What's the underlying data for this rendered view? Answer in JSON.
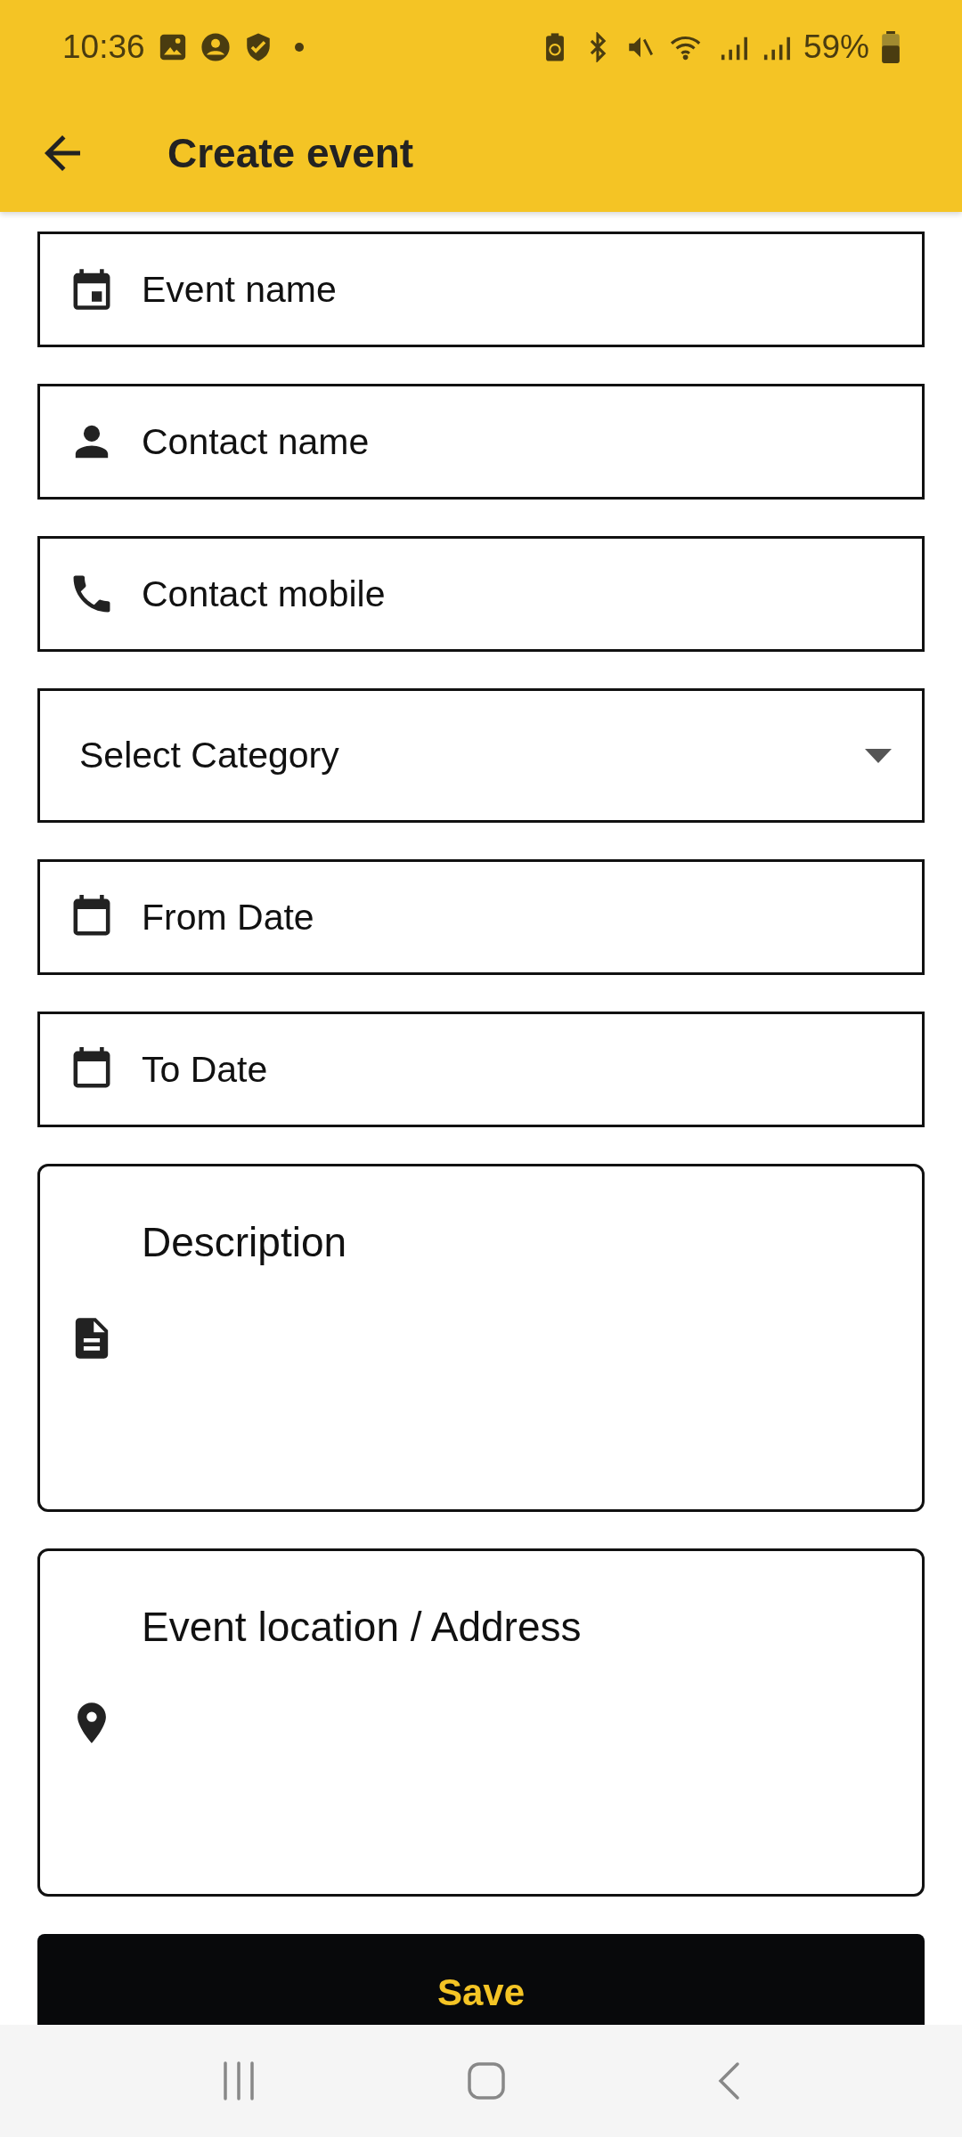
{
  "status_bar": {
    "time": "10:36",
    "battery": "59%"
  },
  "app_bar": {
    "title": "Create event"
  },
  "fields": [
    {
      "kind": "text",
      "placeholder": "Event name"
    },
    {
      "kind": "text",
      "placeholder": "Contact name"
    },
    {
      "kind": "text",
      "placeholder": "Contact mobile"
    },
    {
      "kind": "select",
      "placeholder": "Select Category"
    },
    {
      "kind": "text",
      "placeholder": "From Date"
    },
    {
      "kind": "text",
      "placeholder": "To Date"
    },
    {
      "kind": "multiline",
      "placeholder": "Description"
    },
    {
      "kind": "multiline",
      "placeholder": "Event location / Address"
    }
  ],
  "save_button": {
    "label": "Save"
  }
}
